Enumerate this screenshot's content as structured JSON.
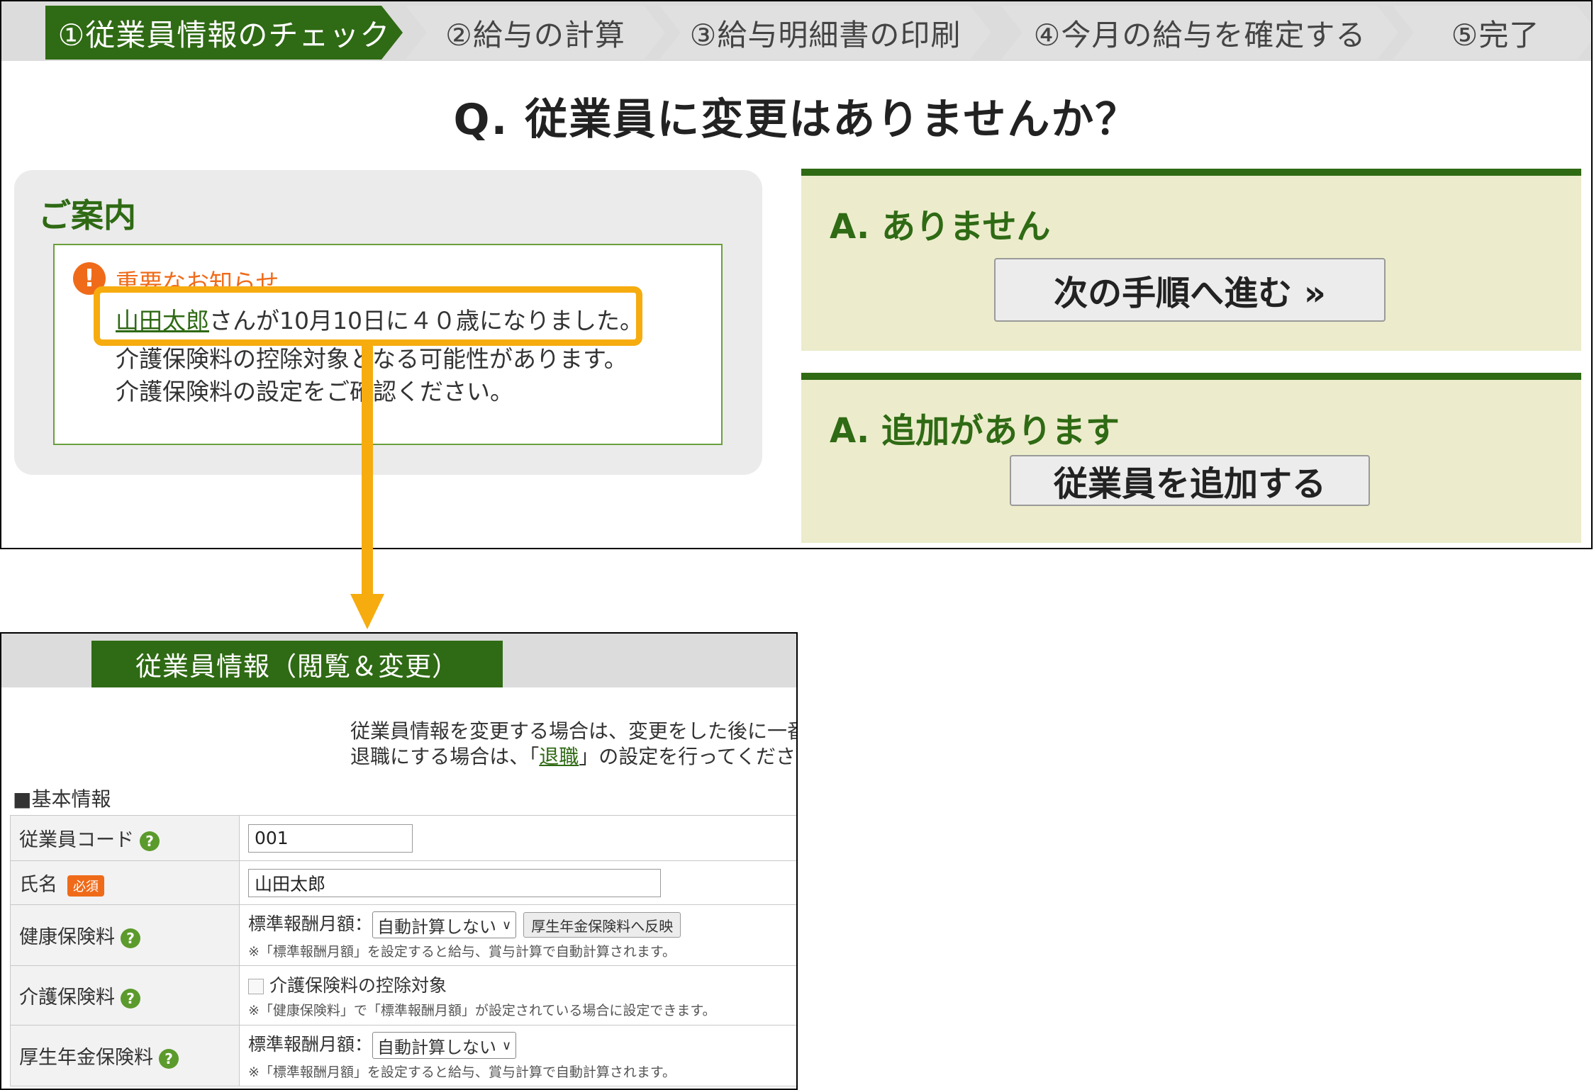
{
  "steps": [
    {
      "label": "①従業員情報のチェック",
      "active": true
    },
    {
      "label": "②給与の計算",
      "active": false
    },
    {
      "label": "③給与明細書の印刷",
      "active": false
    },
    {
      "label": "④今月の給与を確定する",
      "active": false
    },
    {
      "label": "⑤完了",
      "active": false
    }
  ],
  "question": "Q. 従業員に変更はありませんか？",
  "guide": {
    "title": "ご案内",
    "notice_icon": "!",
    "notice_heading": "重要なお知らせ",
    "employee_link": "山田太郎",
    "line1_rest": "さんが10月10日に４０歳になりました。",
    "line2": "介護保険料の控除対象となる可能性があります。",
    "line3": "介護保険料の設定をご確認ください。"
  },
  "answers": {
    "none_label": "A. ありません",
    "next_button": "次の手順へ進む »",
    "add_label": "A. 追加があります",
    "add_button": "従業員を追加する"
  },
  "employee_form": {
    "tab": "従業員情報（閲覧＆変更）",
    "intro1": "従業員情報を変更する場合は、変更をした後に一番",
    "intro2_pre": "退職にする場合は、「",
    "intro2_link": "退職",
    "intro2_post": "」の設定を行ってください。",
    "section": "■基本情報",
    "help_icon": "?",
    "code_label": "従業員コード",
    "code_value": "001",
    "name_label": "氏名",
    "required_badge": "必須",
    "name_value": "山田太郎",
    "health_label": "健康保険料",
    "std_label": "標準報酬月額：",
    "select_value": "自動計算しない",
    "reflect_button": "厚生年金保険料へ反映",
    "health_note": "※「標準報酬月額」を設定すると給与、賞与計算で自動計算されます。",
    "care_label": "介護保険料",
    "care_checkbox": "介護保険料の控除対象",
    "care_note": "※「健康保険料」で「標準報酬月額」が設定されている場合に設定できます。",
    "pension_label": "厚生年金保険料",
    "pension_note": "※「標準報酬月額」を設定すると給与、賞与計算で自動計算されます。"
  }
}
